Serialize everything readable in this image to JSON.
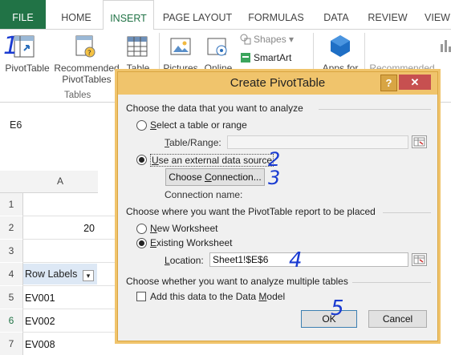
{
  "ribbon_tabs": [
    "FILE",
    "HOME",
    "INSERT",
    "PAGE LAYOUT",
    "FORMULAS",
    "DATA",
    "REVIEW",
    "VIEW"
  ],
  "ribbon": {
    "pivot_table": "PivotTable",
    "recommended_line1": "Recommended",
    "recommended_line2": "PivotTables",
    "table": "Table",
    "pictures": "Pictures",
    "online": "Online",
    "shapes": "Shapes",
    "smartart": "SmartArt",
    "apps_for": "Apps for",
    "recommended_charts": "Recommended",
    "tables_group": "Tables"
  },
  "name_box": "E6",
  "sheet": {
    "column_a": "A",
    "rows": [
      "1",
      "2",
      "3",
      "4",
      "5",
      "6",
      "7"
    ],
    "cell_a2": "20",
    "row_labels_header": "Row Labels",
    "ev001": "EV001",
    "ev002": "EV002",
    "ev008": "EV008"
  },
  "dialog": {
    "title": "Create PivotTable",
    "help": "?",
    "close": "✕",
    "section1": "Choose the data that you want to analyze",
    "select_table_pre": "",
    "select_table_u": "S",
    "select_table_rest": "elect a table or range",
    "table_range_label_u": "T",
    "table_range_label_rest": "able/Range:",
    "external_u": "U",
    "external_rest": "se an external data source",
    "choose_connection_pre": "Choose ",
    "choose_connection_u": "C",
    "choose_connection_rest": "onnection...",
    "connection_name": "Connection name:",
    "section2": "Choose where you want the PivotTable report to be placed",
    "new_worksheet_u": "N",
    "new_worksheet_rest": "ew Worksheet",
    "existing_u": "E",
    "existing_rest": "xisting Worksheet",
    "location_u": "L",
    "location_rest": "ocation:",
    "location_value": "Sheet1!$E$6",
    "section3": "Choose whether you want to analyze multiple tables",
    "add_data_model_pre": "Add this data to the Data ",
    "add_data_model_u": "M",
    "add_data_model_rest": "odel",
    "ok": "OK",
    "cancel": "Cancel",
    "selected_option": "external",
    "placement_selected": "existing",
    "add_to_model_checked": false
  },
  "annotations": [
    "1",
    "2",
    "3",
    "4",
    "5"
  ],
  "colors": {
    "file_tab": "#217346",
    "dialog_title": "#f0c46c",
    "close_button": "#c75050",
    "annotation": "#1a3bd1"
  }
}
